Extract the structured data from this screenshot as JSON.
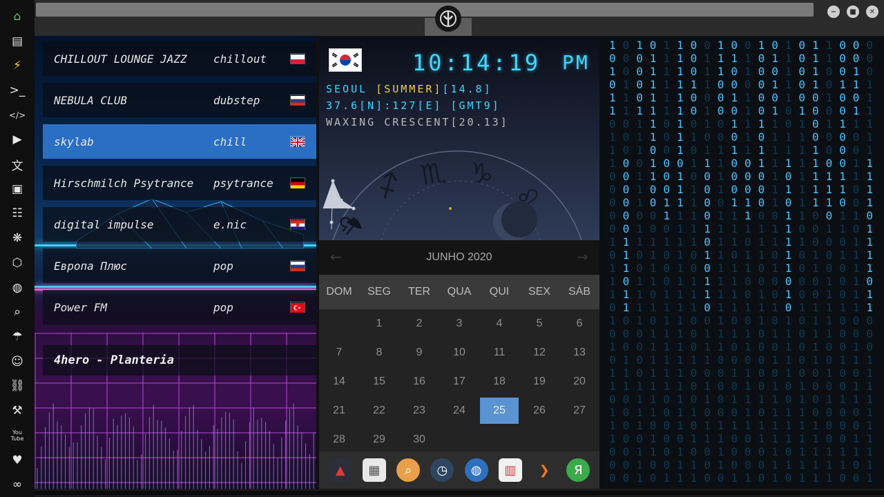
{
  "sidebar": {
    "items": [
      {
        "name": "home-icon",
        "glyph": "⌂"
      },
      {
        "name": "document-icon",
        "glyph": "▤"
      },
      {
        "name": "bolt-icon",
        "glyph": "⚡"
      },
      {
        "name": "terminal-icon",
        "glyph": ">_"
      },
      {
        "name": "code-icon",
        "glyph": "</>"
      },
      {
        "name": "play-icon",
        "glyph": "▶"
      },
      {
        "name": "translate-icon",
        "glyph": "文"
      },
      {
        "name": "image-icon",
        "glyph": "▣"
      },
      {
        "name": "news-icon",
        "glyph": "☷"
      },
      {
        "name": "asterisk-icon",
        "glyph": "❋"
      },
      {
        "name": "hexagon-icon",
        "glyph": "⬡"
      },
      {
        "name": "globe-icon",
        "glyph": "◍"
      },
      {
        "name": "search-icon",
        "glyph": "⌕"
      },
      {
        "name": "umbrella-icon",
        "glyph": "☂"
      },
      {
        "name": "contact-icon",
        "glyph": "☺"
      },
      {
        "name": "link-icon",
        "glyph": "⛓"
      },
      {
        "name": "tools-icon",
        "glyph": "⚒"
      },
      {
        "name": "youtube-icon",
        "glyph": "You\nTube"
      },
      {
        "name": "heart-icon",
        "glyph": "♥"
      },
      {
        "name": "infinity-icon",
        "glyph": "∞"
      }
    ]
  },
  "window": {
    "controls": [
      "−",
      "■",
      "✕"
    ]
  },
  "radio": {
    "stations": [
      {
        "name": "CHILLOUT LOUNGE JAZZ",
        "genre": "chillout",
        "flag": "PL",
        "selected": false
      },
      {
        "name": "NEBULA CLUB",
        "genre": "dubstep",
        "flag": "RU",
        "selected": false
      },
      {
        "name": "skylab",
        "genre": "chill",
        "flag": "GB",
        "selected": true
      },
      {
        "name": "Hirschmilch Psytrance",
        "genre": "psytrance",
        "flag": "DE",
        "selected": false
      },
      {
        "name": "digital impulse",
        "genre": "e.nic",
        "flag": "HR",
        "selected": false
      },
      {
        "name": "Европа Плюс",
        "genre": "pop",
        "flag": "RU",
        "selected": false
      },
      {
        "name": "Power FM",
        "genre": "pop",
        "flag": "TR",
        "selected": false
      }
    ],
    "now_playing": "4hero - Planteria"
  },
  "clock": {
    "time": "10:14:19",
    "ampm": "PM",
    "location_city": "SEOUL ",
    "location_season": "[SUMMER]",
    "location_temp": "[14.8]",
    "coords": "37.6[N]:127[E] [GMT9]",
    "moon": "WAXING CRESCENT[20.13]"
  },
  "calendar": {
    "month_label": "JUNHO 2020",
    "prev": "←",
    "next": "→",
    "weekdays": [
      "DOM",
      "SEG",
      "TER",
      "QUA",
      "QUI",
      "SEX",
      "SÁB"
    ],
    "leading_blanks": 1,
    "days": [
      "1",
      "2",
      "3",
      "4",
      "5",
      "6",
      "7",
      "8",
      "9",
      "10",
      "11",
      "12",
      "13",
      "14",
      "15",
      "16",
      "17",
      "18",
      "19",
      "20",
      "21",
      "22",
      "23",
      "24",
      "25",
      "26",
      "27",
      "28",
      "29",
      "30"
    ],
    "today": "25"
  },
  "dock": {
    "apps": [
      {
        "name": "app-red-triangle-icon",
        "glyph": "▲",
        "bg": "#2a2f3a",
        "fg": "#e03a3a"
      },
      {
        "name": "app-calendar-sheet-icon",
        "glyph": "▦",
        "bg": "#e8e8e8",
        "fg": "#555555"
      },
      {
        "name": "app-search-icon",
        "glyph": "⌕",
        "bg": "#e8a04a",
        "fg": "#ffffff"
      },
      {
        "name": "app-clock-icon",
        "glyph": "◷",
        "bg": "#2f4660",
        "fg": "#ffffff"
      },
      {
        "name": "app-globe-icon",
        "glyph": "◍",
        "bg": "#2e6fc0",
        "fg": "#ffffff"
      },
      {
        "name": "app-calendar-icon",
        "glyph": "▥",
        "bg": "#f1f1f1",
        "fg": "#d23a3a"
      },
      {
        "name": "app-arrow-icon",
        "glyph": "❯",
        "bg": "#2d2d2d",
        "fg": "#f07a2a"
      },
      {
        "name": "app-yandex-icon",
        "glyph": "Я",
        "bg": "#3aaa4a",
        "fg": "#ffffff"
      }
    ]
  },
  "colors": {
    "accent_cyan": "#3fd7ff",
    "accent_yellow": "#f4d03f",
    "selected_blue": "#2a6fc4",
    "today_blue": "#5a93d1",
    "home_green": "#5cc65c"
  },
  "matrix": {
    "columns": [
      "101011011100000101110",
      "000111000000000111011",
      "100001111011101100111",
      "011111110110000111101",
      "111111000000110100011",
      "111111111011111111111",
      "000100010101111100111",
      "011101101100001010110",
      "111000001111011111111",
      "010010101000111101111",
      "011011111000111011001",
      "100000101100001110011",
      "010101111111101101001",
      "111110011101011111010",
      "000001111111110100001",
      "111100001111100011001",
      "110010100011101000111",
      "000100100011011010001",
      "001101100110010111111",
      "000111111111101111011"
    ]
  }
}
